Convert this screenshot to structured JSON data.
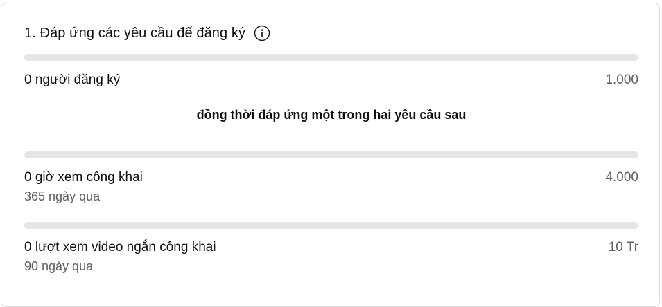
{
  "section": {
    "title": "1. Đáp ứng các yêu cầu để đăng ký",
    "info_icon": "info-circle-icon"
  },
  "requirements": {
    "subscribers": {
      "label": "0 người đăng ký",
      "target": "1.000",
      "progress": 0
    },
    "note": "đồng thời đáp ứng một trong hai yêu cầu sau",
    "watch_hours": {
      "label": "0 giờ xem công khai",
      "period": "365 ngày qua",
      "target": "4.000",
      "progress": 0
    },
    "shorts_views": {
      "label": "0 lượt xem video ngắn công khai",
      "period": "90 ngày qua",
      "target": "10 Tr",
      "progress": 0
    }
  }
}
